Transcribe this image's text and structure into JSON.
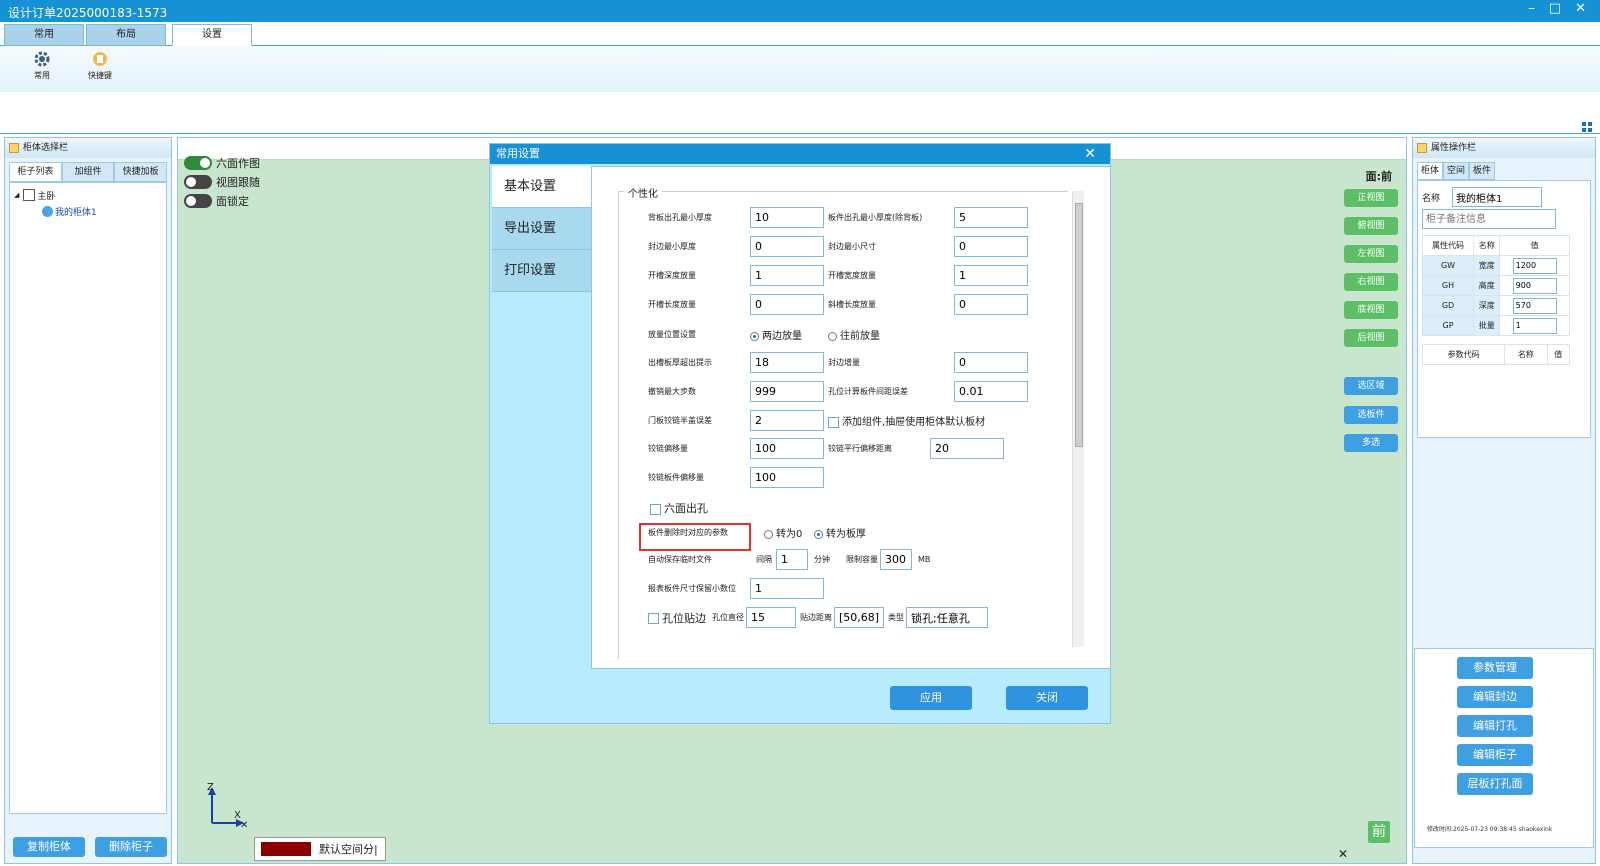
{
  "window": {
    "title": "设计订单2025000183-1573",
    "controls": [
      "–",
      "□",
      "✕"
    ]
  },
  "tabs": [
    {
      "label": "常用"
    },
    {
      "label": "布局"
    },
    {
      "label": "设置"
    }
  ],
  "ribbon": {
    "general_label": "常用",
    "shortcut_label": "快捷键"
  },
  "left_panel": {
    "title": "柜体选择栏",
    "tabs": [
      "柜子列表",
      "加组件",
      "快捷加板"
    ],
    "tree_root": "主卧",
    "tree_child": "我的柜体1",
    "copy_button": "复制柜体",
    "delete_button": "删除柜子"
  },
  "canvas": {
    "toggles": [
      {
        "label": "六面作图",
        "on": true
      },
      {
        "label": "视图跟随",
        "on": false
      },
      {
        "label": "面锁定",
        "on": false
      }
    ],
    "view_label": "面:前",
    "view_buttons": [
      "正视图",
      "俯视图",
      "左视图",
      "右视图",
      "底视图",
      "后视图"
    ],
    "select_buttons": [
      "选区域",
      "选板件",
      "多选"
    ],
    "axis_x": "X",
    "axis_z": "Z",
    "status_text": "默认空间分|",
    "cube_label": "前",
    "close_mark": "✕"
  },
  "dialog": {
    "title": "常用设置",
    "close": "✕",
    "nav": [
      "基本设置",
      "导出设置",
      "打印设置"
    ],
    "group_title": "个性化",
    "fields": {
      "back_hole_min": {
        "label": "背板出孔最小厚度",
        "value": "10"
      },
      "panel_hole_min": {
        "label": "板件出孔最小厚度(除背板)",
        "value": "5"
      },
      "edge_min_thick": {
        "label": "封边最小厚度",
        "value": "0"
      },
      "edge_min_size": {
        "label": "封边最小尺寸",
        "value": "0"
      },
      "groove_depth": {
        "label": "开槽深度放量",
        "value": "1"
      },
      "groove_width": {
        "label": "开槽宽度放量",
        "value": "1"
      },
      "groove_length": {
        "label": "开槽长度放量",
        "value": "0"
      },
      "slant_groove_length": {
        "label": "斜槽长度放量",
        "value": "0"
      },
      "margin_position": {
        "label": "放量位置设置",
        "option_a": "两边放量",
        "option_b": "往前放量"
      },
      "groove_exceed": {
        "label": "出槽板厚超出提示",
        "value": "18"
      },
      "edge_add": {
        "label": "封边增量",
        "value": "0"
      },
      "undo_steps": {
        "label": "撤销最大步数",
        "value": "999"
      },
      "hole_tolerance": {
        "label": "孔位计算板件间距误差",
        "value": "0.01"
      },
      "hinge_half_error": {
        "label": "门板铰链半盖误差",
        "value": "2"
      },
      "add_component": {
        "label": "添加组件,抽屉使用柜体默认板材"
      },
      "hinge_offset": {
        "label": "铰链偏移量",
        "value": "100"
      },
      "hinge_parallel": {
        "label": "铰链平行偏移距离",
        "value": "20"
      },
      "hinge_panel_offset": {
        "label": "铰链板件偏移量",
        "value": "100"
      },
      "six_side_hole": {
        "label": "六面出孔"
      },
      "delete_param": {
        "label": "板件删除时对应的参数",
        "option_a": "转为0",
        "option_b": "转为板厚"
      },
      "autosave": {
        "label": "自动保存临时文件",
        "interval_label": "间隔",
        "interval_value": "1",
        "unit_min": "分钟",
        "cap_label": "限制容量",
        "cap_value": "300",
        "unit_mb": "MB"
      },
      "report_decimals": {
        "label": "报表板件尺寸保留小数位",
        "value": "1"
      },
      "hole_edge": {
        "label": "孔位贴边",
        "diameter_label": "孔位直径",
        "diameter_value": "15",
        "distance_label": "贴边距离",
        "distance_value": "[50,68]",
        "type_label": "类型",
        "type_value": "锁孔;任意孔"
      }
    },
    "apply_button": "应用",
    "close_button": "关闭"
  },
  "right_panel": {
    "title": "属性操作栏",
    "tabs": [
      "柜体",
      "空间",
      "板件"
    ],
    "name_label": "名称",
    "name_value": "我的柜体1",
    "note_placeholder": "柜子备注信息",
    "table_headers": [
      "属性代码",
      "名称",
      "值"
    ],
    "props": [
      {
        "code": "GW",
        "name": "宽度",
        "value": "1200"
      },
      {
        "code": "GH",
        "name": "高度",
        "value": "900"
      },
      {
        "code": "GD",
        "name": "深度",
        "value": "570"
      },
      {
        "code": "GP",
        "name": "批量",
        "value": "1"
      }
    ],
    "param_headers": [
      "参数代码",
      "名称",
      "值"
    ],
    "buttons": [
      "参数管理",
      "编辑封边",
      "编辑打孔",
      "编辑柜子",
      "层板打孔面"
    ],
    "footer": "修改时间:2025-07-23 09:38:45 shaokexink"
  }
}
